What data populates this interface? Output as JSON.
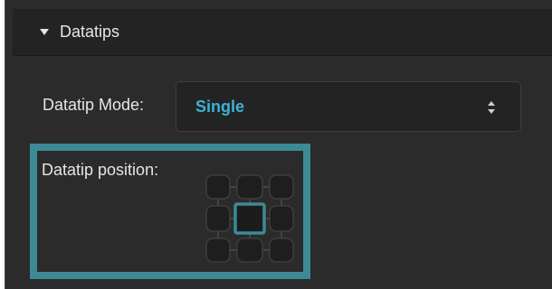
{
  "datatips": {
    "header_title": "Datatips",
    "mode": {
      "label": "Datatip Mode:",
      "selected_value": "Single",
      "value_color": "#3db1d6"
    },
    "position": {
      "label": "Datatip position:",
      "selected_cell": "center",
      "cells": [
        "top-left",
        "top-center",
        "top-right",
        "middle-left",
        "center",
        "middle-right",
        "bottom-left",
        "bottom-center",
        "bottom-right"
      ],
      "highlight_color": "#3c8a95",
      "selected_color": "#3c8a95"
    }
  }
}
